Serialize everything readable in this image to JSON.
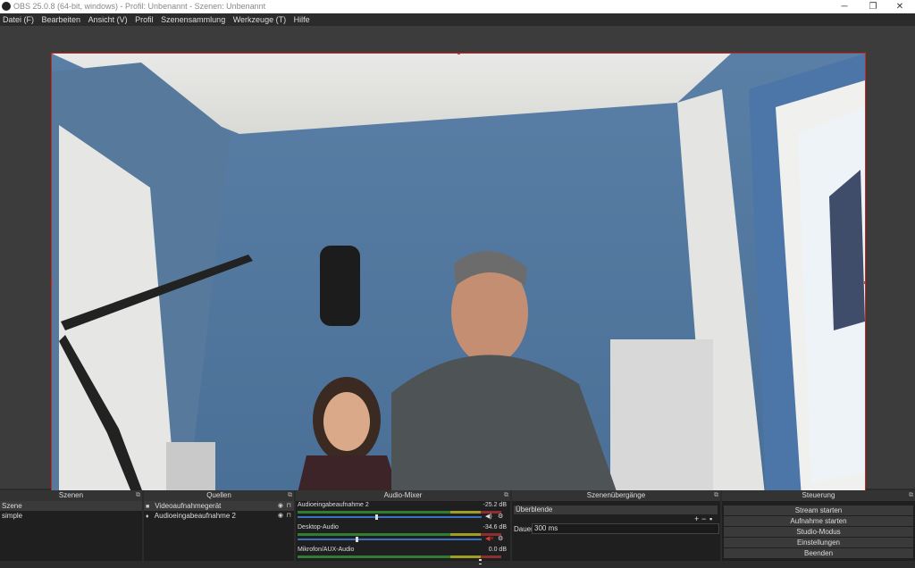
{
  "window": {
    "title": "OBS 25.0.8 (64-bit, windows) - Profil: Unbenannt - Szenen: Unbenannt"
  },
  "window_controls": {
    "minimize": "─",
    "maximize": "❐",
    "close": "✕"
  },
  "menu": {
    "items": [
      "Datei (F)",
      "Bearbeiten",
      "Ansicht (V)",
      "Profil",
      "Szenensammlung",
      "Werkzeuge (T)",
      "Hilfe"
    ]
  },
  "colors": {
    "accent": "#3d6fbf",
    "selection_border": "#c62828",
    "dark_bg": "#2b2b2b"
  },
  "scenes": {
    "title": "Szenen",
    "items": [
      "Szene",
      "simple"
    ]
  },
  "sources": {
    "title": "Quellen",
    "items": [
      {
        "label": "Videoaufnahmegerät",
        "icon": "camera-icon"
      },
      {
        "label": "Audioeingabeaufnahme 2",
        "icon": "microphone-icon"
      }
    ]
  },
  "mixer": {
    "title": "Audio-Mixer",
    "channels": [
      {
        "name": "Audioeingabeaufnahme 2",
        "db": "-25.2 dB",
        "volume": 0.43
      },
      {
        "name": "Desktop-Audio",
        "db": "-34.6 dB",
        "volume": 0.32
      },
      {
        "name": "Mikrofon/AUX-Audio",
        "db": "0.0 dB",
        "volume": 1.0
      }
    ]
  },
  "transitions": {
    "title": "Szenenübergänge",
    "selected": "Überblende",
    "add_label": "+",
    "remove_label": "−",
    "duration_label": "Dauer",
    "duration_value": "300 ms"
  },
  "controls": {
    "title": "Steuerung",
    "buttons": [
      "Stream starten",
      "Aufnahme starten",
      "Studio-Modus",
      "Einstellungen",
      "Beenden"
    ]
  },
  "dock_undock_glyph": "⧉"
}
